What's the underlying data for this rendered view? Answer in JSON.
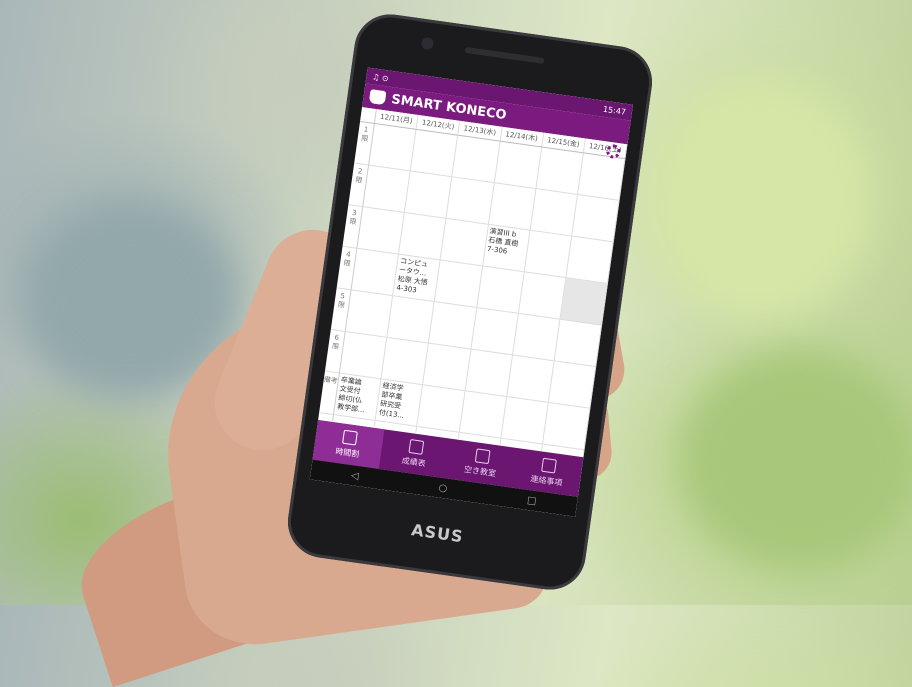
{
  "status_bar": {
    "time": "15:47"
  },
  "app": {
    "title": "SMART KONECO"
  },
  "days": [
    "12/11(月)",
    "12/12(火)",
    "12/13(水)",
    "12/14(木)",
    "12/15(金)",
    "12/16(土)"
  ],
  "periods": [
    "1\n限",
    "2\n限",
    "3\n限",
    "4\n限",
    "5\n限",
    "6\n限",
    "備考"
  ],
  "classes": {
    "d3_p3": "演習III b\n石橋 直樹\n7-306",
    "d1_p4": "コンピュ\nータウ...\n松原 大悟\n4-303",
    "d0_p7": "卒業論\n文受付\n締切(仏\n教学部...",
    "d1_p7": "経済学\n部卒業\n研究受\n付(13..."
  },
  "nav": [
    "時間割",
    "成績表",
    "空き教室",
    "連絡事項"
  ],
  "brand": "ASUS",
  "colors": {
    "primary": "#7b1b80"
  }
}
